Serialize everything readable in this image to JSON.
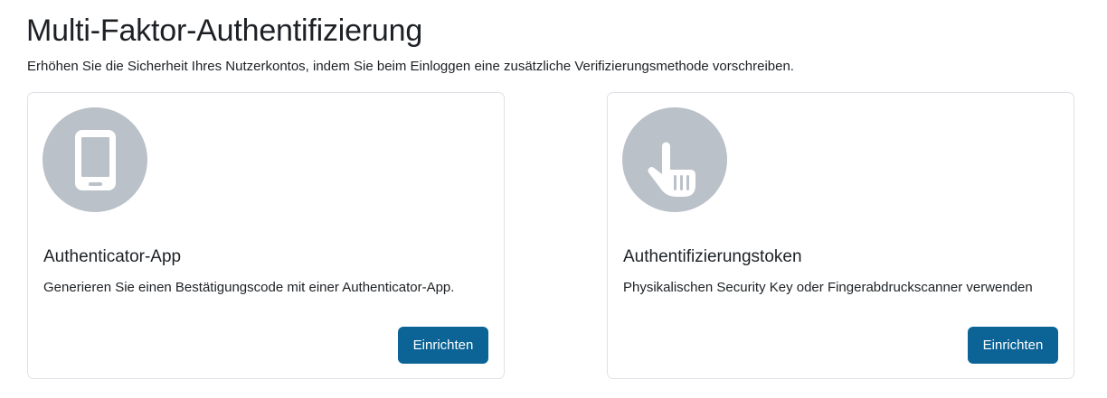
{
  "page": {
    "title": "Multi-Faktor-Authentifizierung",
    "description": "Erhöhen Sie die Sicherheit Ihres Nutzerkontos, indem Sie beim Einloggen eine zusätzliche Verifizierungsmethode vorschreiben."
  },
  "factors": [
    {
      "icon": "mobile-phone-icon",
      "title": "Authenticator-App",
      "description": "Generieren Sie einen Bestätigungscode mit einer Authenticator-App.",
      "button_label": "Einrichten"
    },
    {
      "icon": "pointing-hand-icon",
      "title": "Authentifizierungstoken",
      "description": "Physikalischen Security Key oder Fingerabdruckscanner verwenden",
      "button_label": "Einrichten"
    }
  ],
  "colors": {
    "icon_circle": "#bac1c9",
    "button": "#0b6396",
    "card_border": "#dee2e6"
  }
}
